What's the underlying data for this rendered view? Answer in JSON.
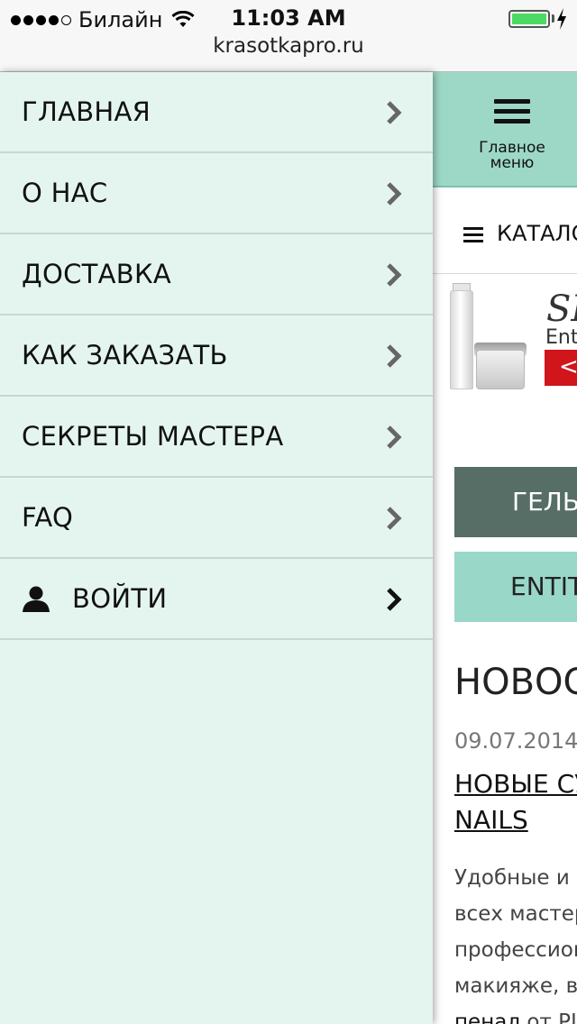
{
  "status_bar": {
    "carrier": "Билайн",
    "time": "11:03 AM",
    "url": "krasotkapro.ru",
    "signal_icon": "signal-dots-icon",
    "wifi_icon": "wifi-icon",
    "battery_icon": "battery-icon",
    "battery_level": 1.0
  },
  "drawer": {
    "background": "#e4f5f0",
    "items": [
      {
        "label": "ГЛАВНАЯ"
      },
      {
        "label": "О НАС"
      },
      {
        "label": "ДОСТАВКА"
      },
      {
        "label": "КАК ЗАКАЗАТЬ"
      },
      {
        "label": "СЕКРЕТЫ МАСТЕРА"
      },
      {
        "label": "FAQ"
      }
    ],
    "login": {
      "label": "ВОЙТИ",
      "icon": "user-icon"
    }
  },
  "content": {
    "menu_button_label": "Главное меню",
    "catalog_label": "КАТАЛОГ",
    "banner": {
      "brand": "SPA",
      "sub": "Ent",
      "button_glyph": "<"
    },
    "gel_button": "ГЕЛЬ-",
    "entity_button": "ENTIT",
    "news_title": "НОВОС",
    "news_date": "09.07.2014",
    "news_link_line1": "НОВЫЕ СУ",
    "news_link_line2": "NAILS",
    "news_text": [
      "Удобные и",
      "всех мастер",
      "профессиона",
      "макияже, в"
    ],
    "news_text_link": "пенал",
    "news_text_tail": " от PL",
    "colors": {
      "menu_button": "#9dd8c6",
      "gel_button": "#566e65",
      "entity_button": "#99d8c8",
      "banner_button": "#d0151b"
    }
  }
}
